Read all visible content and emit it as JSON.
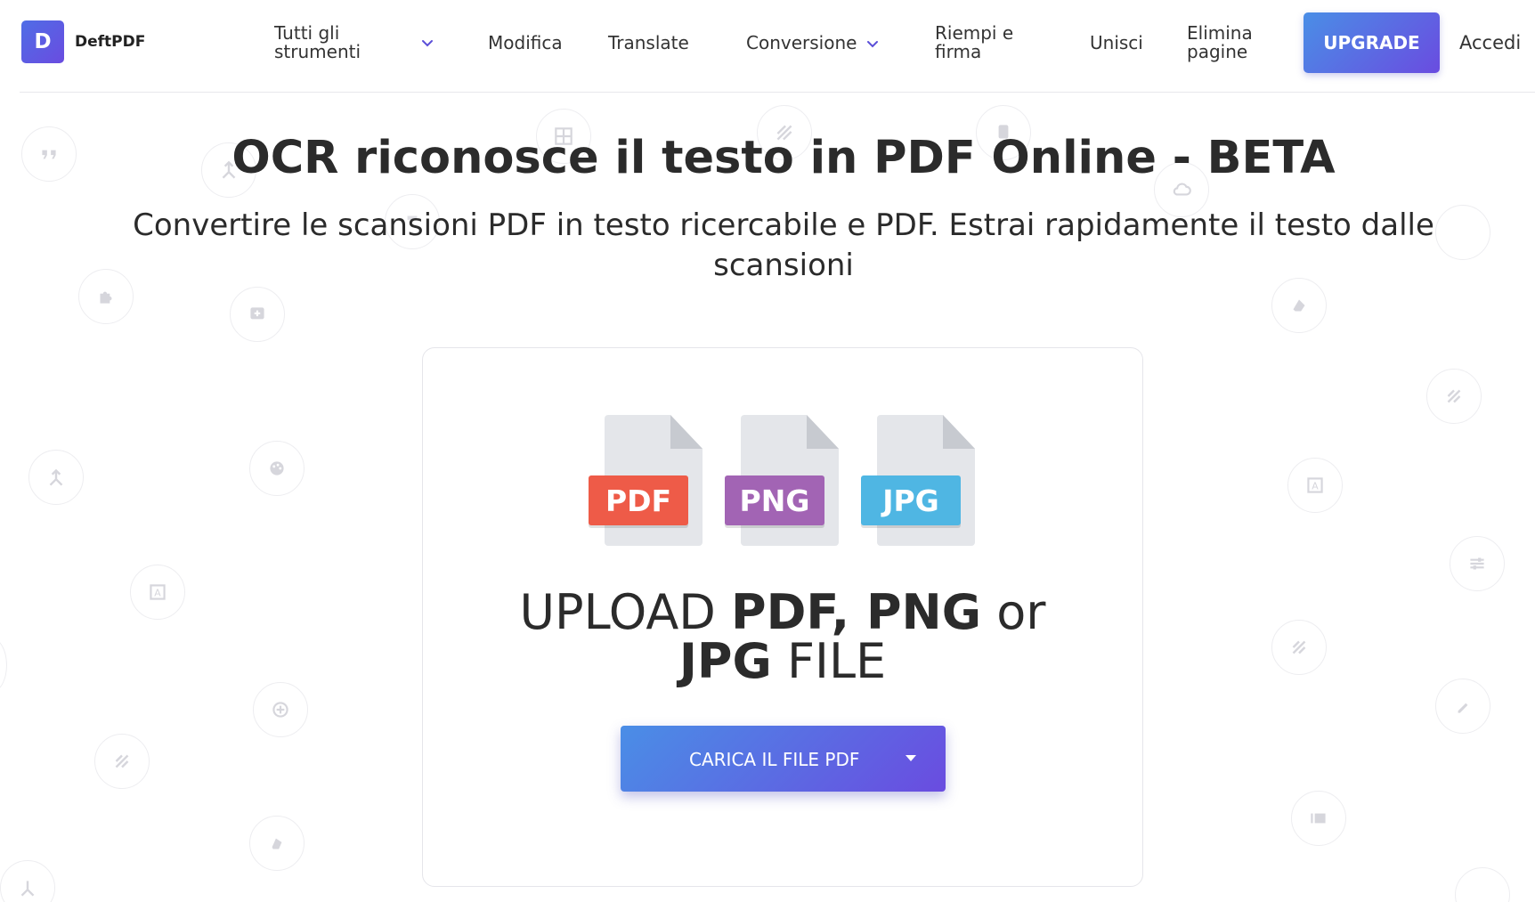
{
  "header": {
    "logo_letter": "D",
    "logo_text": "DeftPDF",
    "nav": {
      "all_tools_line1": "Tutti gli",
      "all_tools_line2": "strumenti",
      "edit": "Modifica",
      "translate": "Translate",
      "conversion": "Conversione",
      "fill_sign_line1": "Riempi e",
      "fill_sign_line2": "firma",
      "merge": "Unisci",
      "delete_pages_line1": "Elimina",
      "delete_pages_line2": "pagine"
    },
    "upgrade": "UPGRADE",
    "login": "Accedi"
  },
  "hero": {
    "title": "OCR riconosce il testo in PDF Online - BETA",
    "subtitle": "Convertire le scansioni PDF in testo ricercabile e PDF. Estrai rapidamente il testo dalle scansioni"
  },
  "upload": {
    "file_types": [
      {
        "label": "PDF",
        "color": "#ee5b48"
      },
      {
        "label": "PNG",
        "color": "#a264b4"
      },
      {
        "label": "JPG",
        "color": "#4fb6e3"
      }
    ],
    "text": {
      "w1": "UPLOAD ",
      "b1": "PDF, PNG",
      "w2": " or",
      "b2": "JPG",
      "w3": " FILE"
    },
    "button": "CARICA IL FILE PDF"
  },
  "colors": {
    "accent_start": "#4a8ee6",
    "accent_end": "#6a4ce0"
  }
}
